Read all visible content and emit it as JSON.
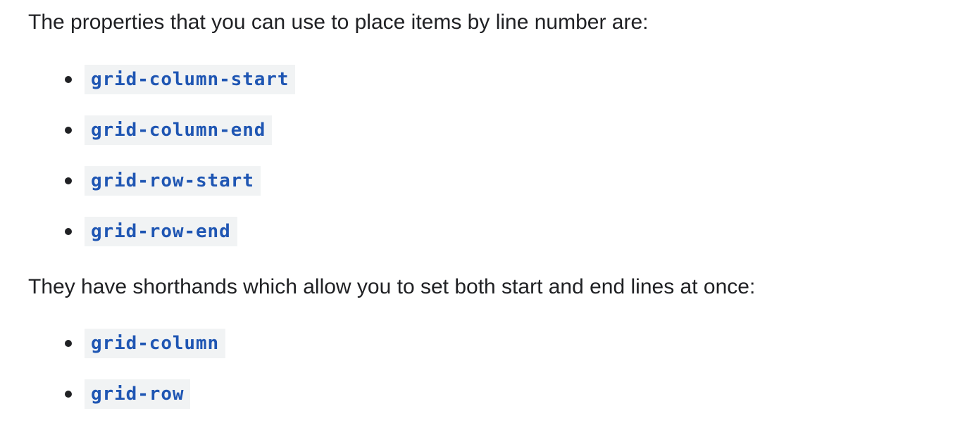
{
  "paragraphs": {
    "intro": "The properties that you can use to place items by line number are:",
    "shorthand": "They have shorthands which allow you to set both start and end lines at once:"
  },
  "line_properties": [
    "grid-column-start",
    "grid-column-end",
    "grid-row-start",
    "grid-row-end"
  ],
  "shorthand_properties": [
    "grid-column",
    "grid-row"
  ],
  "colors": {
    "text": "#202124",
    "code_text": "#1f56b3",
    "code_background": "#f1f3f4"
  }
}
